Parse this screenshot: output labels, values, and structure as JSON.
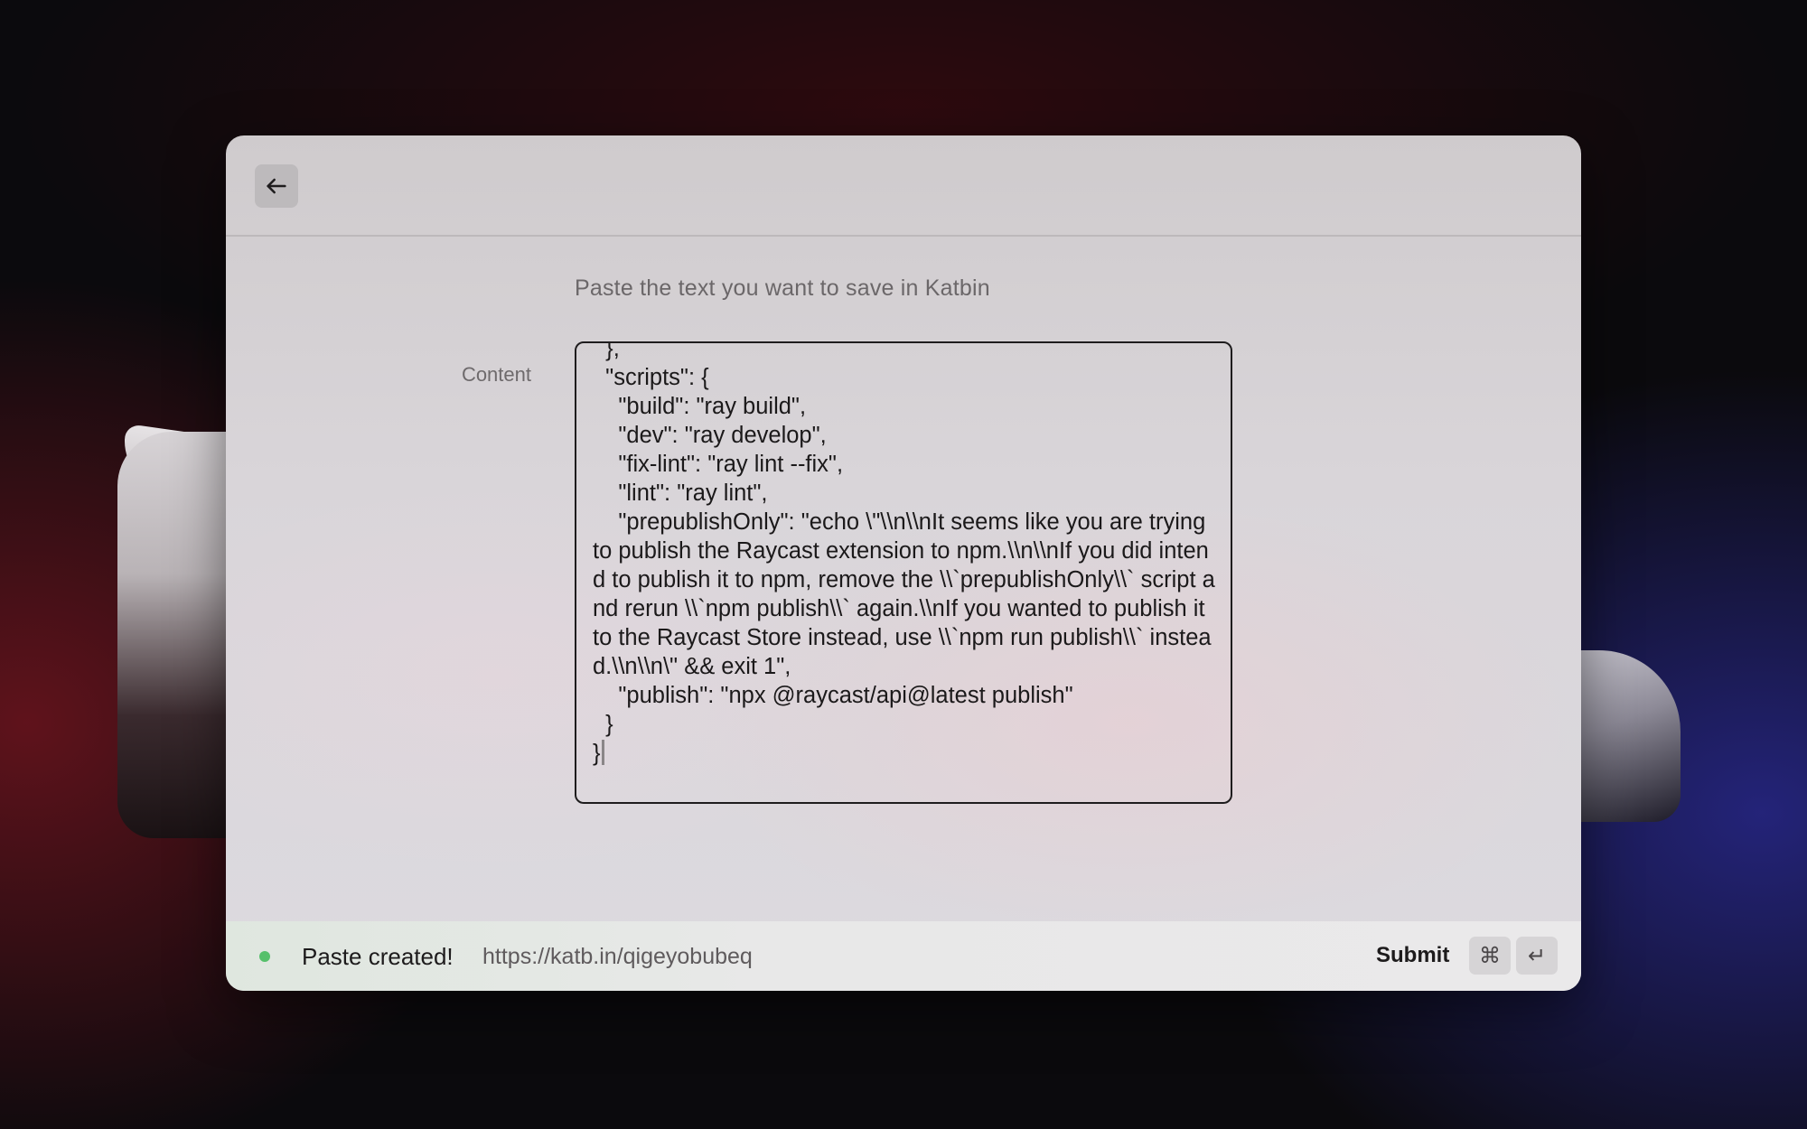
{
  "window": {
    "back_label": "Back"
  },
  "form": {
    "description": "Paste the text you want to save in Katbin",
    "content_label": "Content",
    "content_value": "  },\n  \"scripts\": {\n    \"build\": \"ray build\",\n    \"dev\": \"ray develop\",\n    \"fix-lint\": \"ray lint --fix\",\n    \"lint\": \"ray lint\",\n    \"prepublishOnly\": \"echo \\\"\\\\n\\\\nIt seems like you are trying to publish the Raycast extension to npm.\\\\n\\\\nIf you did intend to publish it to npm, remove the \\\\`prepublishOnly\\\\` script and rerun \\\\`npm publish\\\\` again.\\\\nIf you wanted to publish it to the Raycast Store instead, use \\\\`npm run publish\\\\` instead.\\\\n\\\\n\\\" && exit 1\",\n    \"publish\": \"npx @raycast/api@latest publish\"\n  }\n}"
  },
  "footer": {
    "status_text": "Paste created!",
    "status_url": "https://katb.in/qigeyobubeq",
    "status_color": "#56c06b",
    "submit_label": "Submit",
    "shortcut_keys": [
      "⌘",
      "↵"
    ]
  },
  "icons": {
    "back": "arrow-left-icon",
    "status": "status-dot-icon"
  }
}
